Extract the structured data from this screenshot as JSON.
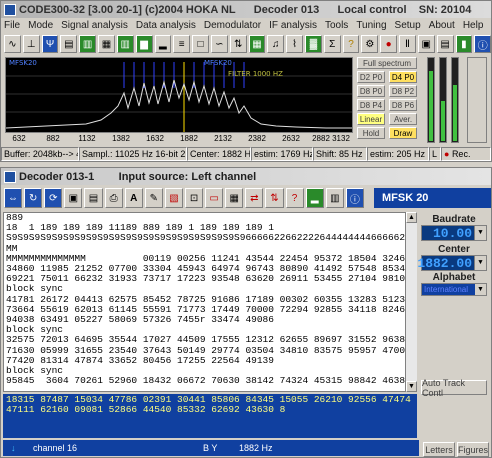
{
  "main_window": {
    "title": "CODE300-32 [3.00 20-1] (c)2004 HOKA NL      Decoder 013      Local control    SN: 20104",
    "menu": [
      "File",
      "Mode",
      "Signal analysis",
      "Data analysis",
      "Demodulator",
      "IF analysis",
      "Tools",
      "Tuning",
      "Setup",
      "About",
      "Help"
    ],
    "toolbar_icons": [
      "scope-icon",
      "scope2-icon",
      "filter-icon",
      "bars-icon",
      "waterfall-icon",
      "bars2-icon",
      "waterfall2-icon",
      "spectrum-icon",
      "spectrum2-icon",
      "list-icon",
      "square-icon",
      "scope3-icon",
      "shift-icon",
      "grid-icon",
      "sound-icon",
      "graph-icon",
      "sonogram-icon",
      "sigma-icon",
      "help-icon",
      "config-icon",
      "record-icon",
      "pause-icon",
      "save-icon",
      "film-icon",
      "level-icon",
      "info-icon"
    ],
    "spectrum": {
      "label_left": "MFSK20",
      "label_mid": "MFSK20",
      "label_filter": "FILTER 1000 HZ",
      "axis_ticks": [
        "632",
        "882",
        "1132",
        "1382",
        "1632",
        "1882",
        "2132",
        "2382",
        "2632",
        "2882",
        "3132"
      ]
    },
    "right_buttons": {
      "full_spectrum": "Full spectrum",
      "d2p0": "D2 P0",
      "d4p0": "D4 P0",
      "d8p0": "D8 P0",
      "d8p2": "D8 P2",
      "d8p4": "D8 P4",
      "d8p6": "D8 P6",
      "linear": "Linear",
      "aver": "Aver.",
      "hold": "Hold",
      "draw": "Draw"
    },
    "status": {
      "buffer": "Buffer: 2048kb--> 48 s",
      "sampl": "Sampl.: 11025 Hz 16-bit 2 Ch",
      "center": "Center: 1882 Hz",
      "estim1": "estim: 1769 Hz",
      "shift": "Shift: 85 Hz",
      "estim2": "estim: 205 Hz",
      "l": "L",
      "rec": "Rec."
    }
  },
  "decoder_window": {
    "title": "Decoder 013-1        Input source: Left channel",
    "mode_badge": "MFSK 20",
    "received_lines": [
      "889",
      "18  1 189 189 189 11189 889 189 1 189 189 189 1",
      "S9S9S9S9S9S9S9S9S9S9S9S9S9S9S9S9S9S9S9S9S966666226622226444444446666622666226266MMMM",
      "MM",
      "MMMMMMMMMMMMMM          00119 00256 11241 43544 22454 95372 18504 32460",
      "34860 11985 21252 07700 33304 45943 64974 96743 80890 41492 57548 85346",
      "69221 75011 66232 31933 73717 17223 93548 63620 26911 53455 27104 98102",
      "block sync",
      "41781 26172 04413 62575 85452 78725 91686 17189 00302 60355 13283 51233",
      "73664 55619 62013 61145 55591 71773 17449 70000 72294 92855 34118 82460",
      "94038 63491 05227 58069 57326 7455r 33474 49086",
      "block sync",
      "32575 72013 64695 35544 17027 44509 17555 12312 62655 89697 31552 96388",
      "71630 05999 31655 23540 37643 50149 29774 03504 34810 83575 95957 47008",
      "77420 81314 47874 33652 80456 17255 22564 49139",
      "block sync",
      "95845  3604 70261 52960 18432 06672 70630 38142 74324 45315 98842 46380"
    ],
    "transmit_lines": [
      "18315 87487 15034 47786 02391 30441 85806 84345 15055 26210 92556 47474",
      "47111 62160 09081 52866 44540 85332 62692 43630 8"
    ],
    "baudrate": {
      "label": "Baudrate",
      "value": "10.00"
    },
    "center": {
      "label": "Center",
      "value": "1882.00"
    },
    "alphabet": {
      "label": "Alphabet",
      "value": "International"
    },
    "auto_track": "Auto Track Contl",
    "status": {
      "channel": "channel 16",
      "by": "B Y",
      "hz": "1882 Hz"
    },
    "letters": "Letters",
    "figures": "Figures"
  }
}
